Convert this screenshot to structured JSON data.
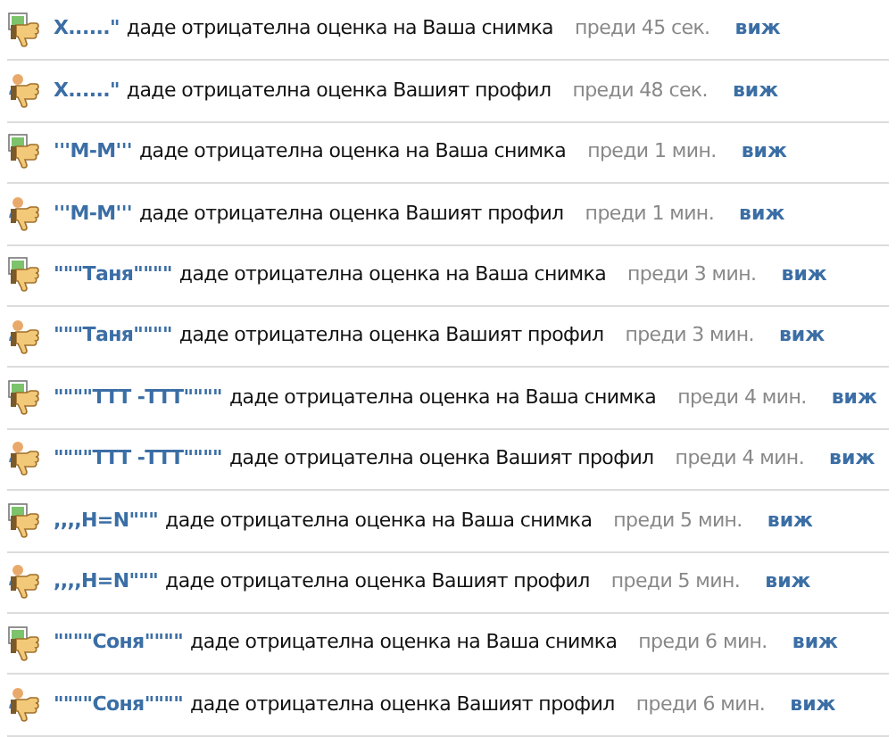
{
  "notifications": [
    {
      "kind": "photo",
      "user": "Х......\"",
      "action": "даде отрицателна оценка на Ваша снимка",
      "time": "преди 45 сек.",
      "link": "виж"
    },
    {
      "kind": "profile",
      "user": "Х......\"",
      "action": "даде отрицателна оценка Вашият профил",
      "time": "преди 48 сек.",
      "link": "виж"
    },
    {
      "kind": "photo",
      "user": "'''М-М'''",
      "action": "даде отрицателна оценка на Ваша снимка",
      "time": "преди 1 мин.",
      "link": "виж"
    },
    {
      "kind": "profile",
      "user": "'''М-М'''",
      "action": "даде отрицателна оценка Вашият профил",
      "time": "преди 1 мин.",
      "link": "виж"
    },
    {
      "kind": "photo",
      "user": "\"\"\"Таня\"\"\"\"",
      "action": "даде отрицателна оценка на Ваша снимка",
      "time": "преди 3 мин.",
      "link": "виж"
    },
    {
      "kind": "profile",
      "user": "\"\"\"Таня\"\"\"\"",
      "action": "даде отрицателна оценка Вашият профил",
      "time": "преди 3 мин.",
      "link": "виж"
    },
    {
      "kind": "photo",
      "user": "\"\"\"\"ТТТ -ТТТ\"\"\"\"",
      "action": "даде отрицателна оценка на Ваша снимка",
      "time": "преди 4 мин.",
      "link": "виж"
    },
    {
      "kind": "profile",
      "user": "\"\"\"\"ТТТ -ТТТ\"\"\"\"",
      "action": "даде отрицателна оценка Вашият профил",
      "time": "преди 4 мин.",
      "link": "виж"
    },
    {
      "kind": "photo",
      "user": ",,,,Н=N\"\"\"",
      "action": "даде отрицателна оценка на Ваша снимка",
      "time": "преди 5 мин.",
      "link": "виж"
    },
    {
      "kind": "profile",
      "user": ",,,,Н=N\"\"\"",
      "action": "даде отрицателна оценка Вашият профил",
      "time": "преди 5 мин.",
      "link": "виж"
    },
    {
      "kind": "photo",
      "user": "\"\"\"\"Соня\"\"\"\"",
      "action": "даде отрицателна оценка на Ваша снимка",
      "time": "преди 6 мин.",
      "link": "виж"
    },
    {
      "kind": "profile",
      "user": "\"\"\"\"Соня\"\"\"\"",
      "action": "даде отрицателна оценка Вашият профил",
      "time": "преди 6 мин.",
      "link": "виж"
    }
  ]
}
